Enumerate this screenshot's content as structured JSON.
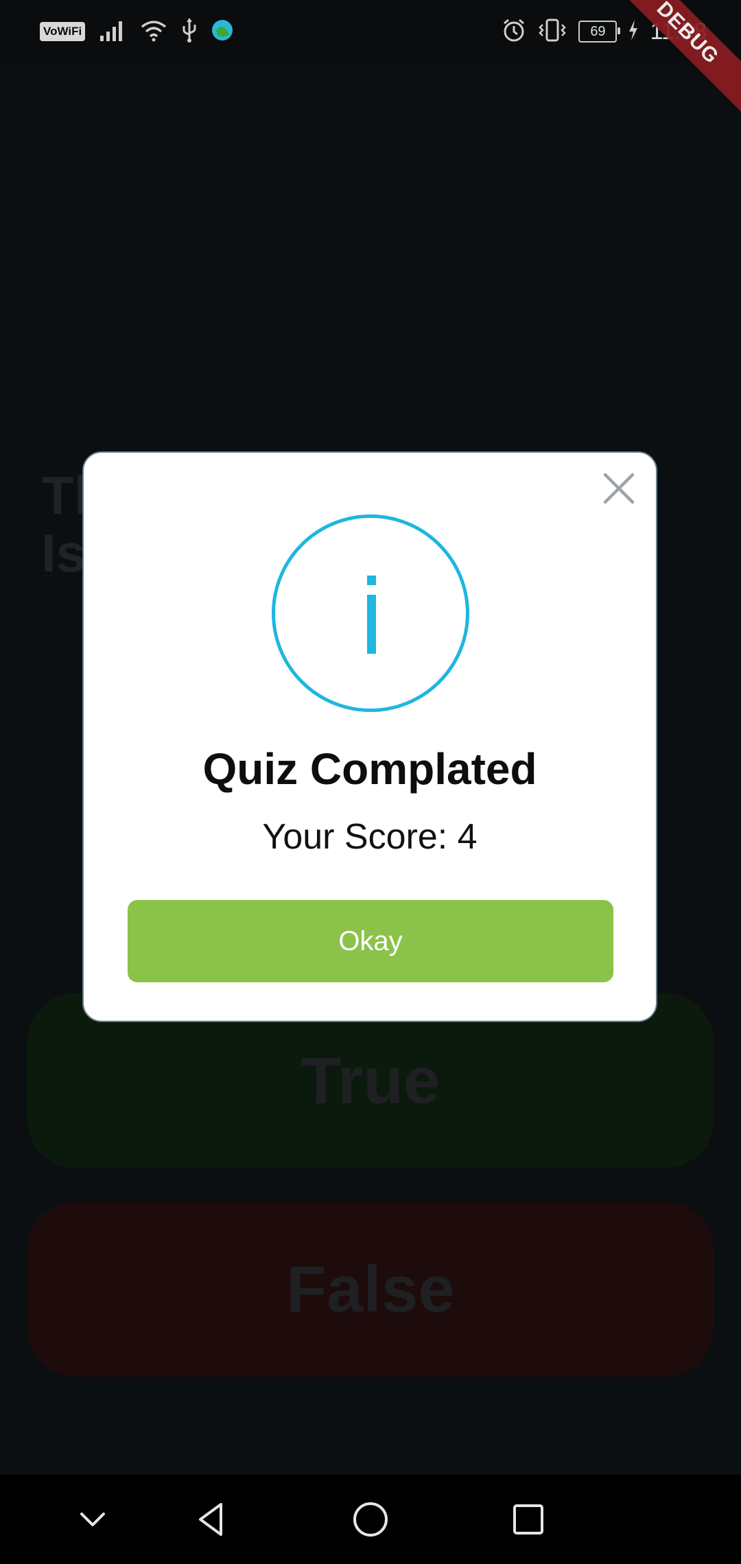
{
  "status_bar": {
    "vowifi_label": "VoWiFi",
    "battery_level": "69",
    "time": "11:58",
    "icons": [
      "signal-icon",
      "wifi-icon",
      "usb-icon",
      "app-notification-icon",
      "alarm-icon",
      "vibrate-icon",
      "battery-icon",
      "charging-icon"
    ]
  },
  "debug_banner": "DEBUG",
  "background": {
    "question": "Th\nIs",
    "true_label": "True",
    "false_label": "False"
  },
  "dialog": {
    "title": "Quiz Complated",
    "score_text": "Your Score: 4",
    "ok_label": "Okay",
    "close_icon": "close-icon",
    "info_icon": "info-icon"
  },
  "colors": {
    "info_accent": "#1fb6e0",
    "okay_button": "#8bc34a",
    "debug_banner": "#8b1d22"
  },
  "nav_bar": {
    "icons": [
      "collapse-icon",
      "back-icon",
      "home-icon",
      "recents-icon"
    ]
  }
}
